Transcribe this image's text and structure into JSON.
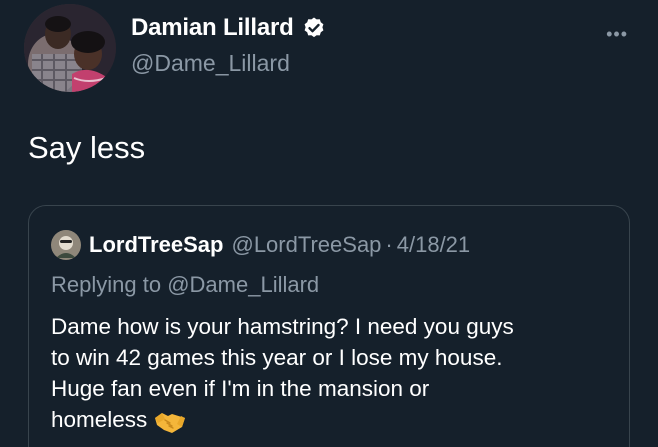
{
  "author": {
    "display_name": "Damian Lillard",
    "handle": "@Dame_Lillard",
    "verified": true,
    "avatar_icon": "profile-photo"
  },
  "menu": {
    "more_icon": "more-horizontal-icon",
    "more_label": "•••"
  },
  "tweet": {
    "text": "Say less"
  },
  "quoted_tweet": {
    "author_name": "LordTreeSap",
    "author_handle": "@LordTreeSap",
    "separator": "·",
    "date": "4/18/21",
    "replying_prefix": "Replying to",
    "replying_to": "@Dame_Lillard",
    "lines": [
      "Dame how is your hamstring? I need you guys",
      "to win 42 games this year or I lose my house.",
      "Huge fan even if I'm in the mansion or",
      "homeless"
    ],
    "emoji_icon": "handshake-emoji"
  },
  "colors": {
    "background": "#15202b",
    "secondary_text": "#8b98a5",
    "border": "#38444d",
    "verified_badge": "#ffffff"
  }
}
